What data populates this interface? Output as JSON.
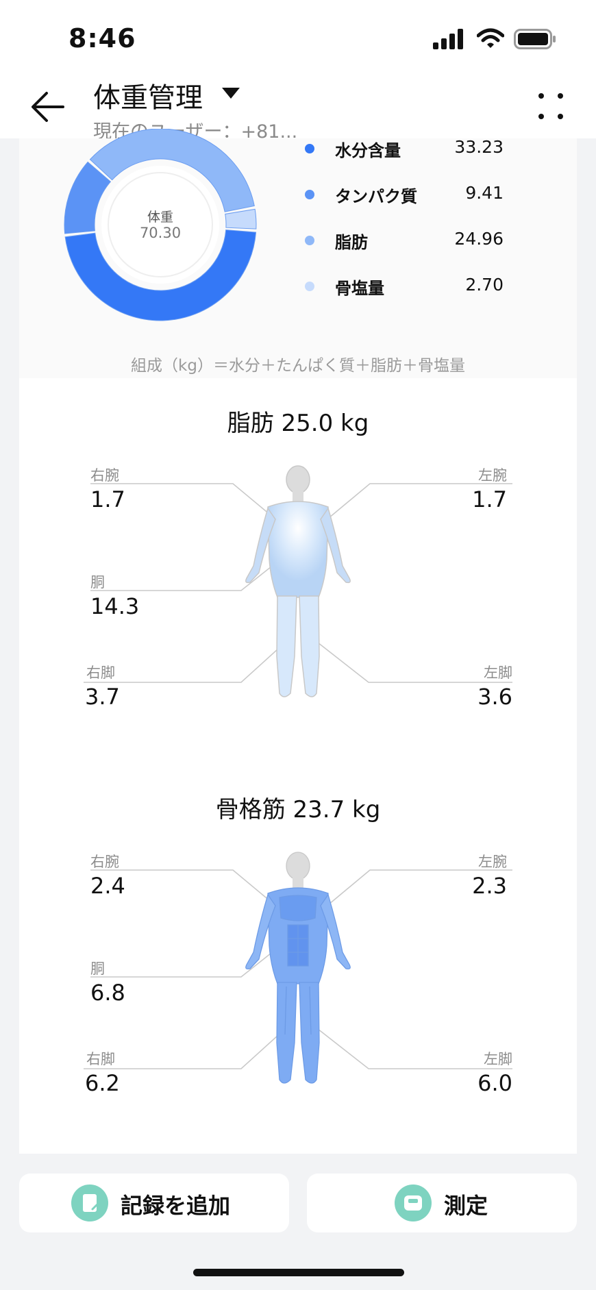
{
  "status_bar": {
    "time": "8:46"
  },
  "header": {
    "title": "体重管理",
    "subtitle": "現在のユーザー：+81..."
  },
  "composition": {
    "center_label": "体重",
    "center_value": "70.30",
    "items": [
      {
        "label": "水分含量",
        "value": "33.23",
        "color": "#3478f6"
      },
      {
        "label": "タンパク質",
        "value": "9.41",
        "color": "#5b93f5"
      },
      {
        "label": "脂肪",
        "value": "24.96",
        "color": "#8fb8f8"
      },
      {
        "label": "骨塩量",
        "value": "2.70",
        "color": "#c6dbfc"
      }
    ],
    "formula": "組成（kg）＝水分＋たんぱく質＋脂肪＋骨塩量"
  },
  "fat": {
    "title": "脂肪 25.0 kg",
    "right_arm_label": "右腕",
    "right_arm_value": "1.7",
    "left_arm_label": "左腕",
    "left_arm_value": "1.7",
    "trunk_label": "胴",
    "trunk_value": "14.3",
    "right_leg_label": "右脚",
    "right_leg_value": "3.7",
    "left_leg_label": "左脚",
    "left_leg_value": "3.6"
  },
  "muscle": {
    "title": "骨格筋 23.7 kg",
    "right_arm_label": "右腕",
    "right_arm_value": "2.4",
    "left_arm_label": "左腕",
    "left_arm_value": "2.3",
    "trunk_label": "胴",
    "trunk_value": "6.8",
    "right_leg_label": "右脚",
    "right_leg_value": "6.2",
    "left_leg_label": "左脚",
    "left_leg_value": "6.0"
  },
  "actions": {
    "add_record": "記録を追加",
    "measure": "測定"
  },
  "icons": [
    "back-arrow-icon",
    "dropdown-caret-icon",
    "more-icon",
    "signal-icon",
    "wifi-icon",
    "battery-icon",
    "edit-note-icon",
    "scale-icon"
  ]
}
